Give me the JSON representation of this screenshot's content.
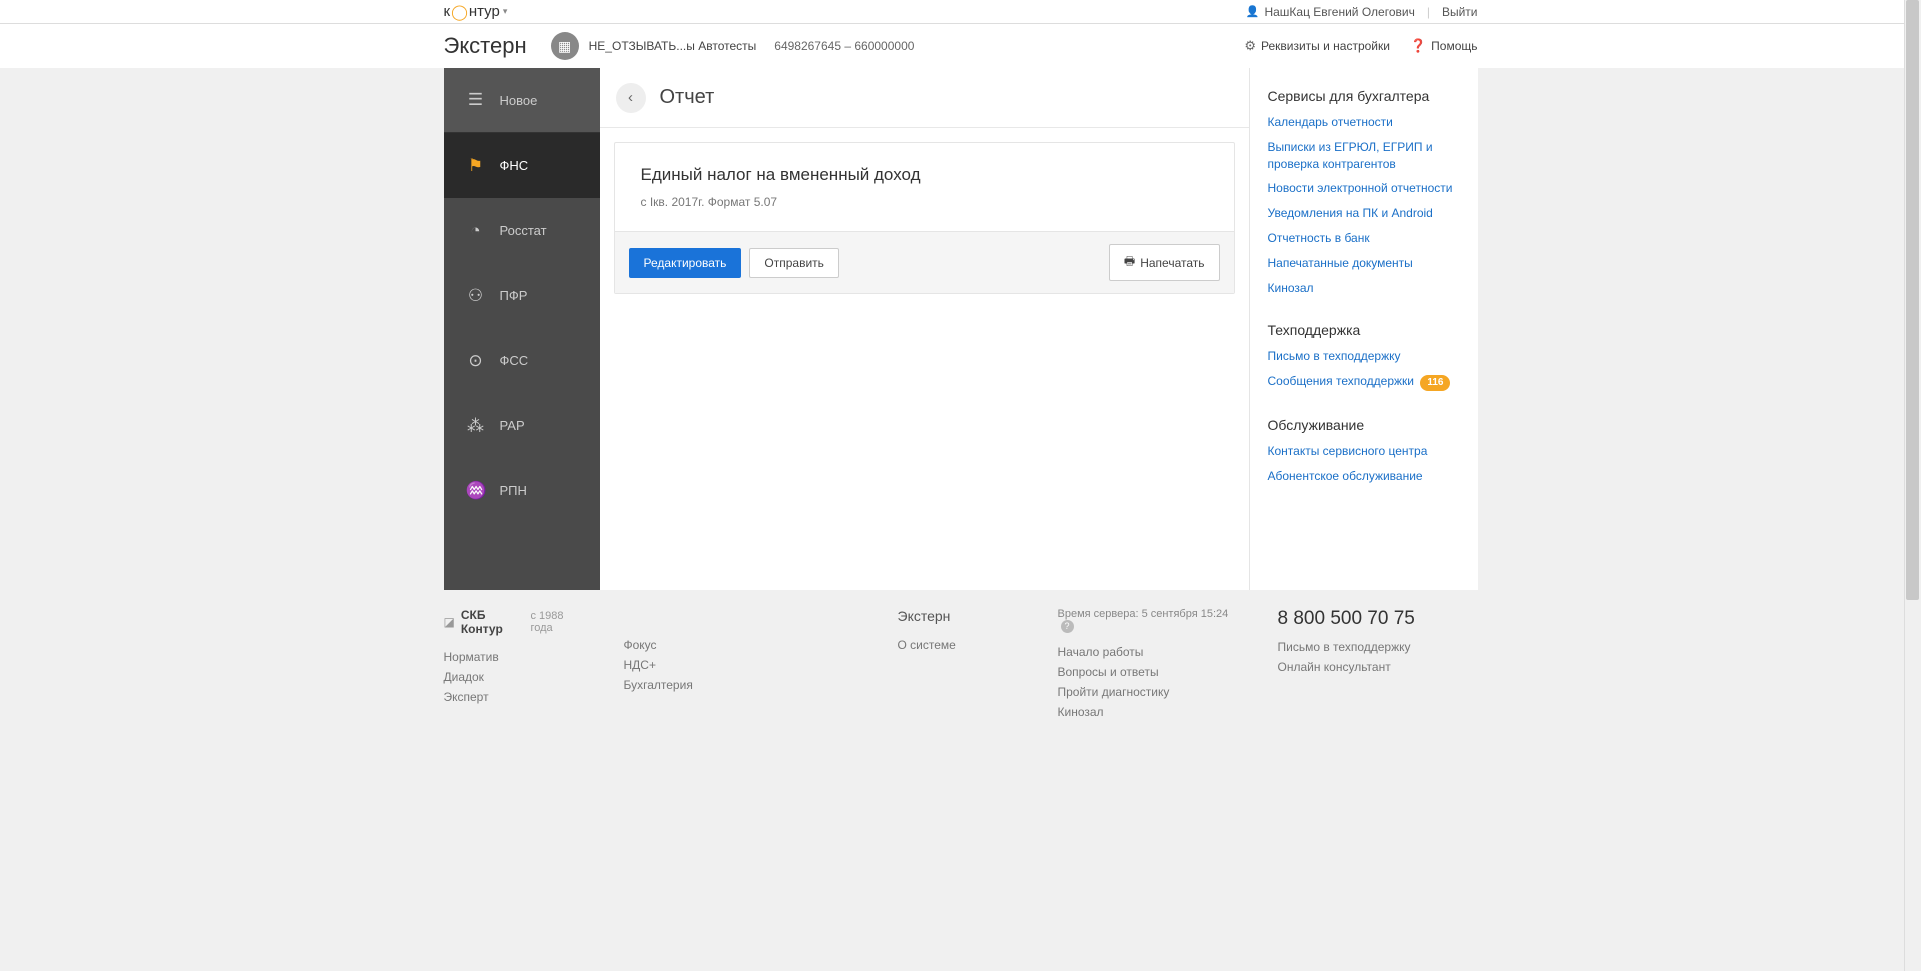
{
  "topbar": {
    "brand_prefix": "к",
    "brand_suffix": "нтур",
    "user_name": "НашКац Евгений Олегович",
    "logout": "Выйти"
  },
  "header": {
    "app_title": "Экстерн",
    "org_name": "НЕ_ОТЗЫВАТЬ...ы Автотесты",
    "org_codes": "6498267645 – 660000000",
    "settings": "Реквизиты и настройки",
    "help": "Помощь"
  },
  "sidebar": {
    "items": [
      {
        "label": "Новое"
      },
      {
        "label": "ФНС"
      },
      {
        "label": "Росстат"
      },
      {
        "label": "ПФР"
      },
      {
        "label": "ФСС"
      },
      {
        "label": "РАР"
      },
      {
        "label": "РПН"
      }
    ]
  },
  "content": {
    "page_title": "Отчет",
    "card": {
      "title": "Единый налог на вмененный доход",
      "subtitle": "с Iкв. 2017г. Формат 5.07",
      "edit": "Редактировать",
      "send": "Отправить",
      "print": "Напечатать"
    }
  },
  "right": {
    "s1_title": "Сервисы для бухгалтера",
    "s1_links": [
      "Календарь отчетности",
      "Выписки из ЕГРЮЛ, ЕГРИП и проверка контрагентов",
      "Новости электронной отчетности",
      "Уведомления на ПК и Android",
      "Отчетность в банк",
      "Напечатанные документы",
      "Кинозал"
    ],
    "s2_title": "Техподдержка",
    "s2_link1": "Письмо в техподдержку",
    "s2_link2": "Сообщения техподдержки",
    "s2_badge": "116",
    "s3_title": "Обслуживание",
    "s3_links": [
      "Контакты сервисного центра",
      "Абонентское обслуживание"
    ]
  },
  "footer": {
    "brand": "СКБ Контур",
    "since": "с 1988 года",
    "col1": [
      "Норматив",
      "Диадок",
      "Эксперт"
    ],
    "col2": [
      "Фокус",
      "НДС+",
      "Бухгалтерия"
    ],
    "col3_head": "Экстерн",
    "col3": [
      "О системе"
    ],
    "srv_time": "Время сервера: 5 сентября 15:24",
    "col4": [
      "Начало работы",
      "Вопросы и ответы",
      "Пройти диагностику",
      "Кинозал"
    ],
    "phone": "8 800 500 70 75",
    "col5": [
      "Письмо в техподдержку",
      "Онлайн консультант"
    ]
  }
}
